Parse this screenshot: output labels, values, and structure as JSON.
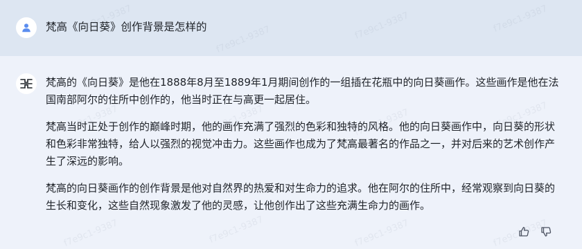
{
  "user_message": {
    "avatar_icon": "user-icon",
    "text": "梵高《向日葵》创作背景是怎样的"
  },
  "assistant_message": {
    "avatar_icon": "assistant-logo-icon",
    "paragraphs": [
      "梵高的《向日葵》是他在1888年8月至1889年1月期间创作的一组插在花瓶中的向日葵画作。这些画作是他在法国南部阿尔的住所中创作的，他当时正在与高更一起居住。",
      "梵高当时正处于创作的巅峰时期，他的画作充满了强烈的色彩和独特的风格。他的向日葵画作中，向日葵的形状和色彩非常独特，给人以强烈的视觉冲击力。这些画作也成为了梵高最著名的作品之一，并对后来的艺术创作产生了深远的影响。",
      "梵高的向日葵画作的创作背景是他对自然界的热爱和对生命力的追求。他在阿尔的住所中，经常观察到向日葵的生长和变化，这些自然现象激发了他的灵感，让他创作出了这些充满生命力的画作。"
    ]
  },
  "actions": {
    "like_icon": "thumbs-up-icon",
    "dislike_icon": "thumbs-down-icon"
  },
  "watermark": "f7e9c1-9387",
  "colors": {
    "user_bg": "#dde6f2",
    "assistant_bg": "#eef2fa",
    "text": "#1f2329",
    "user_icon": "#5b8def"
  }
}
